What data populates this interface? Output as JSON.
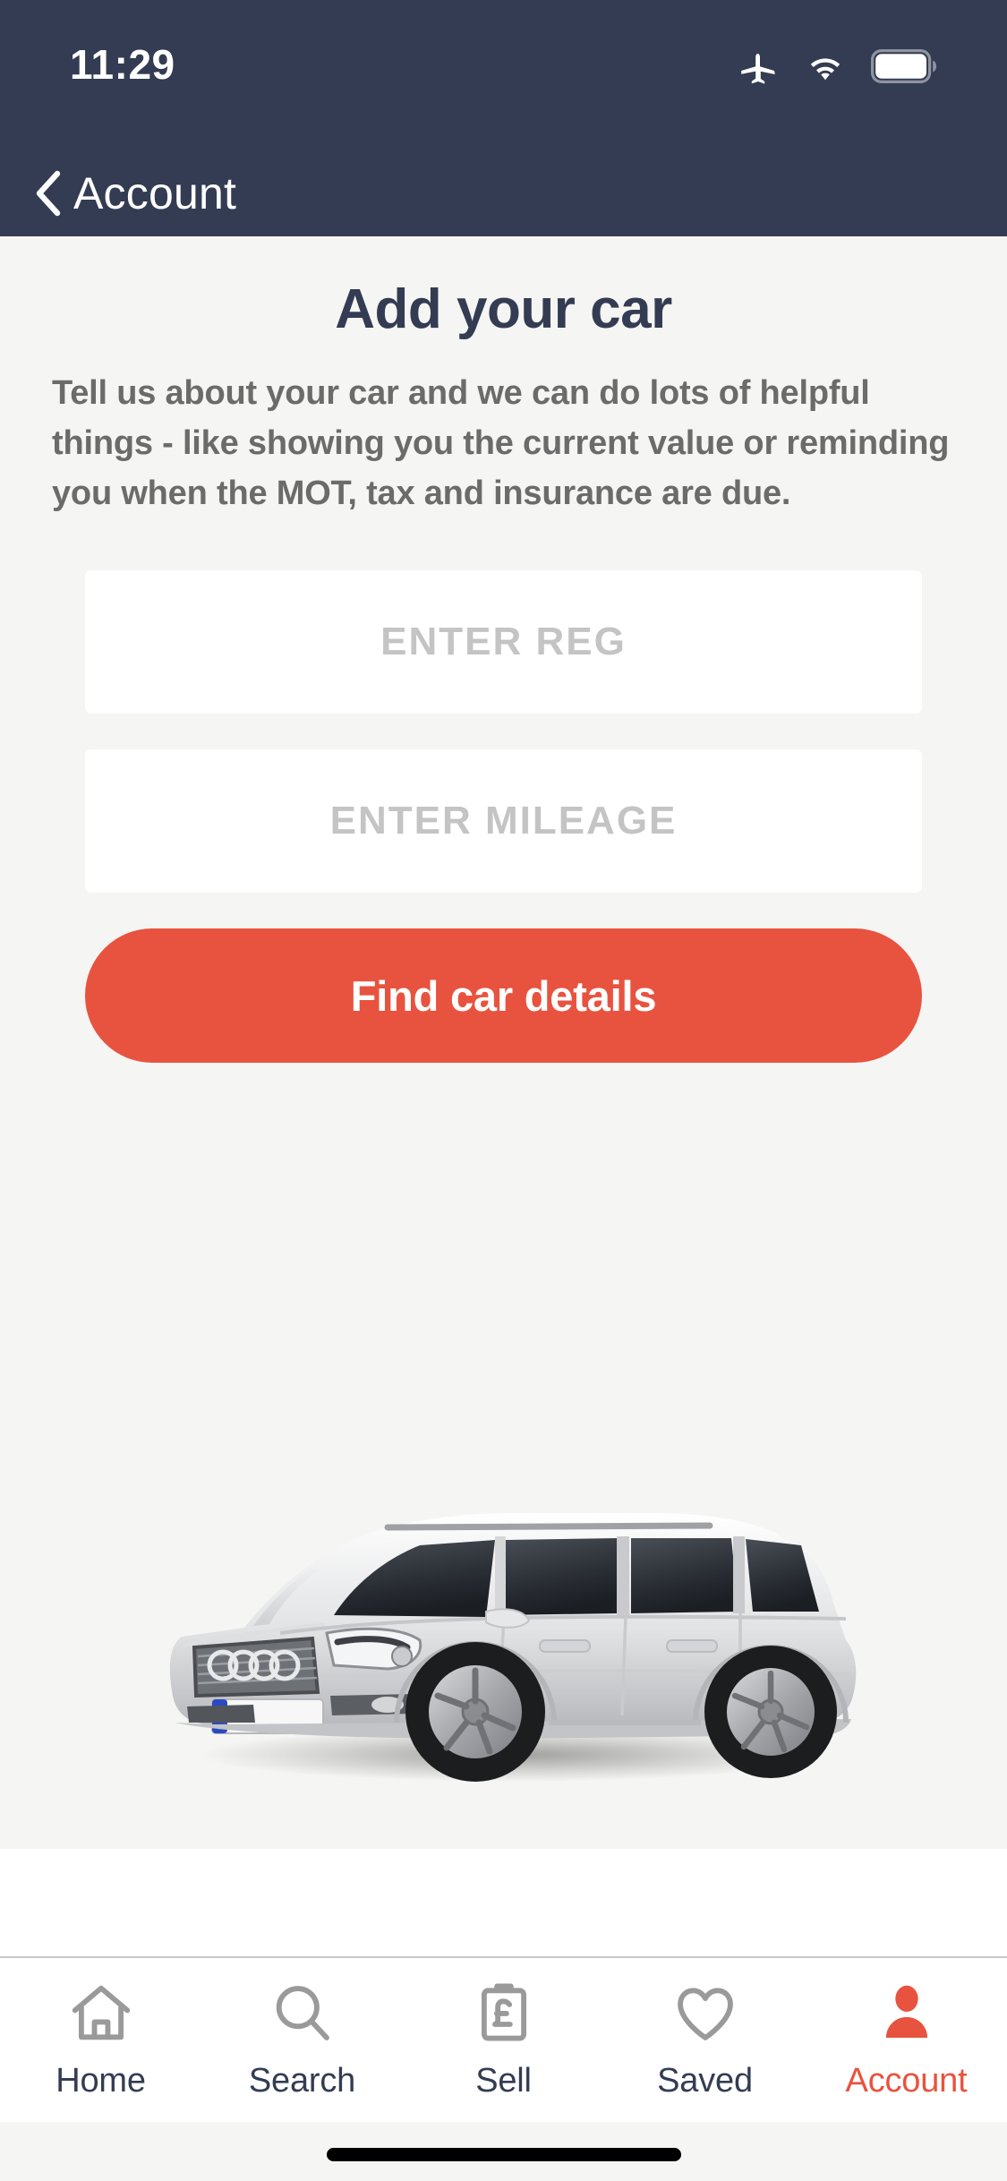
{
  "status_bar": {
    "time": "11:29",
    "icons": [
      "airplane-icon",
      "wifi-icon",
      "battery-icon"
    ]
  },
  "nav": {
    "back_icon": "chevron-left-icon",
    "title": "Account"
  },
  "main": {
    "title": "Add your car",
    "description": "Tell us about your car and we can do lots of helpful things - like showing you the current value or reminding you when the MOT, tax and insurance are due.",
    "fields": [
      {
        "name": "reg",
        "value": "",
        "placeholder": "ENTER REG"
      },
      {
        "name": "mileage",
        "value": "",
        "placeholder": "ENTER MILEAGE"
      }
    ],
    "cta_label": "Find car details",
    "illustration": "white-estate-car-image"
  },
  "tab_bar": {
    "items": [
      {
        "label": "Home",
        "icon": "house-icon",
        "active": false
      },
      {
        "label": "Search",
        "icon": "magnifier-icon",
        "active": false
      },
      {
        "label": "Sell",
        "icon": "clipboard-pound-icon",
        "active": false
      },
      {
        "label": "Saved",
        "icon": "heart-icon",
        "active": false
      },
      {
        "label": "Account",
        "icon": "person-icon",
        "active": true
      }
    ]
  },
  "colors": {
    "header": "#333c52",
    "accent": "#e8533f",
    "background": "#f5f5f3",
    "placeholder": "#c4c4c4",
    "body_text": "#6b6b6b",
    "tab_inactive": "#9a9a9a"
  }
}
